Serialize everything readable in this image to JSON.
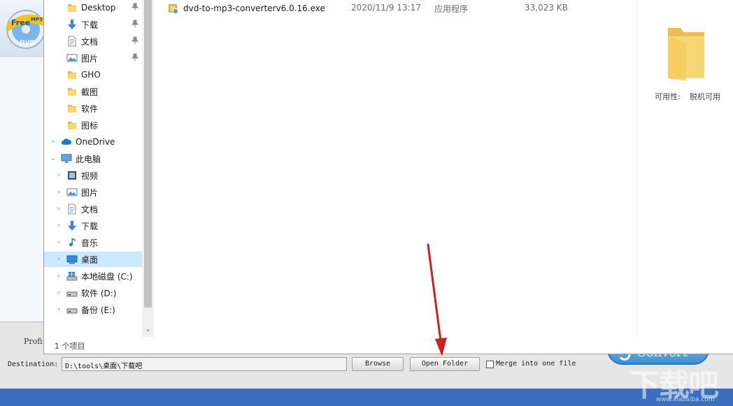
{
  "app": {
    "logo_text": "Free MP3 DVD",
    "profile_label": "Profi",
    "destination_label": "Destination:",
    "destination_value": "D:\\tools\\桌面\\下载吧",
    "browse_label": "Browse",
    "open_folder_label": "Open Folder",
    "merge_label": "Merge into one file",
    "convert_label": "Convert"
  },
  "nav": {
    "items": [
      {
        "label": "Desktop",
        "icon": "folder-icon",
        "pinned": true
      },
      {
        "label": "下载",
        "icon": "download-icon",
        "pinned": true
      },
      {
        "label": "文档",
        "icon": "document-icon",
        "pinned": true
      },
      {
        "label": "图片",
        "icon": "picture-icon",
        "pinned": true
      },
      {
        "label": "GHO",
        "icon": "folder-icon"
      },
      {
        "label": "截图",
        "icon": "folder-icon"
      },
      {
        "label": "软件",
        "icon": "folder-icon"
      },
      {
        "label": "图标",
        "icon": "folder-icon"
      },
      {
        "label": "OneDrive",
        "icon": "cloud-icon"
      },
      {
        "label": "此电脑",
        "icon": "computer-icon"
      },
      {
        "label": "视频",
        "icon": "video-icon"
      },
      {
        "label": "图片",
        "icon": "picture-icon"
      },
      {
        "label": "文档",
        "icon": "document-icon"
      },
      {
        "label": "下载",
        "icon": "download-icon"
      },
      {
        "label": "音乐",
        "icon": "music-icon"
      },
      {
        "label": "桌面",
        "icon": "desktop-icon",
        "selected": true
      },
      {
        "label": "本地磁盘 (C:)",
        "icon": "windows-drive-icon"
      },
      {
        "label": "软件 (D:)",
        "icon": "drive-icon"
      },
      {
        "label": "备份 (E:)",
        "icon": "drive-icon"
      }
    ]
  },
  "files": [
    {
      "name": "dvd-to-mp3-converterv6.0.16.exe",
      "date": "2020/11/9 13:17",
      "type": "应用程序",
      "size": "33,023 KB"
    }
  ],
  "preview": {
    "availability_label": "可用性:",
    "availability_value": "脱机可用"
  },
  "status": {
    "item_count": "1 个项目"
  },
  "watermark": {
    "text": "下载吧",
    "url": "www.xiazaiba.com"
  },
  "colors": {
    "selection": "#cce8ff",
    "folder_yellow": "#f7d774",
    "app_blue": "#3a6fbf",
    "arrow_red": "#cc1f1f"
  }
}
